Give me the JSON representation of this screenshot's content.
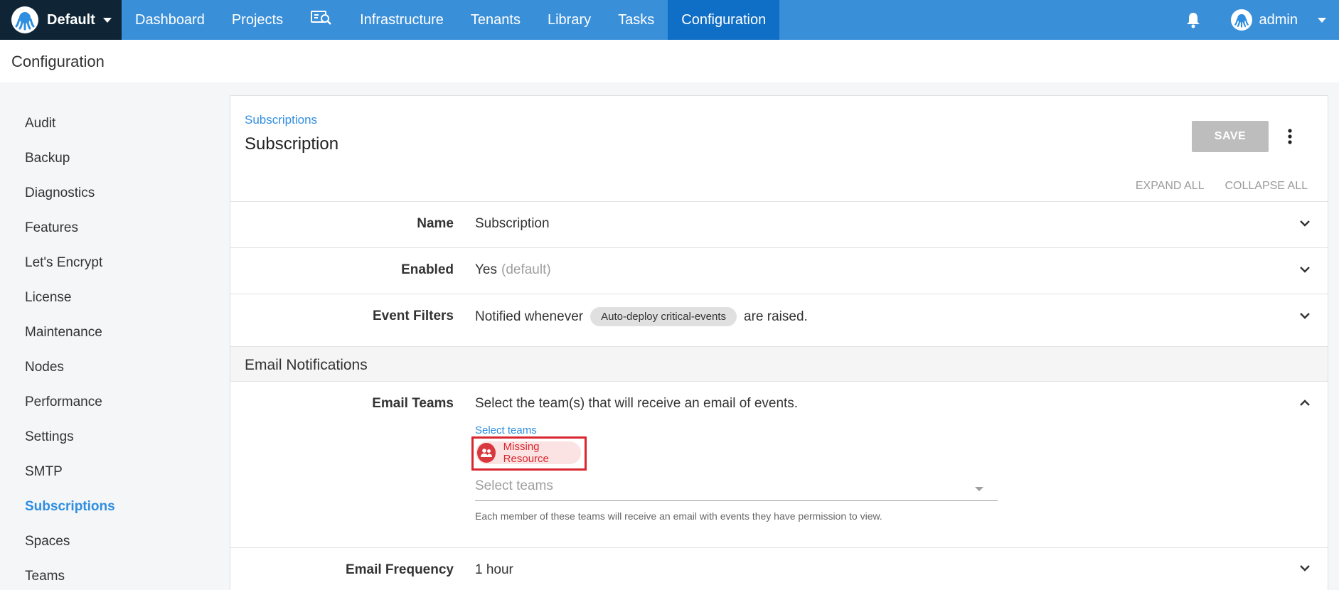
{
  "topnav": {
    "space_name": "Default",
    "items": [
      "Dashboard",
      "Projects",
      "",
      "Infrastructure",
      "Tenants",
      "Library",
      "Tasks",
      "Configuration"
    ],
    "active_index": 7,
    "user": "admin"
  },
  "page": {
    "title": "Configuration"
  },
  "sidebar": {
    "items": [
      "Audit",
      "Backup",
      "Diagnostics",
      "Features",
      "Let's Encrypt",
      "License",
      "Maintenance",
      "Nodes",
      "Performance",
      "Settings",
      "SMTP",
      "Subscriptions",
      "Spaces",
      "Teams"
    ],
    "active": "Subscriptions"
  },
  "card": {
    "breadcrumb": "Subscriptions",
    "title": "Subscription",
    "save_label": "SAVE",
    "expand_all": "EXPAND ALL",
    "collapse_all": "COLLAPSE ALL"
  },
  "rows": {
    "name": {
      "label": "Name",
      "value": "Subscription"
    },
    "enabled": {
      "label": "Enabled",
      "value": "Yes",
      "hint": "(default)"
    },
    "event_filters": {
      "label": "Event Filters",
      "prefix": "Notified whenever",
      "chip": "Auto-deploy critical-events",
      "suffix": "are raised."
    },
    "email_teams": {
      "label": "Email Teams",
      "description": "Select the team(s) that will receive an email of events.",
      "field_label": "Select teams",
      "chip": "Missing Resource",
      "placeholder": "Select teams",
      "help": "Each member of these teams will receive an email with events they have permission to view."
    },
    "email_frequency": {
      "label": "Email Frequency",
      "value": "1 hour"
    }
  },
  "section": {
    "email_notifications": "Email Notifications"
  },
  "colors": {
    "nav_blue": "#3a8fd9",
    "nav_active": "#0f6ec5",
    "nav_dark": "#0f2535",
    "link_blue": "#2f8ee0",
    "error_red": "#d9262e"
  }
}
